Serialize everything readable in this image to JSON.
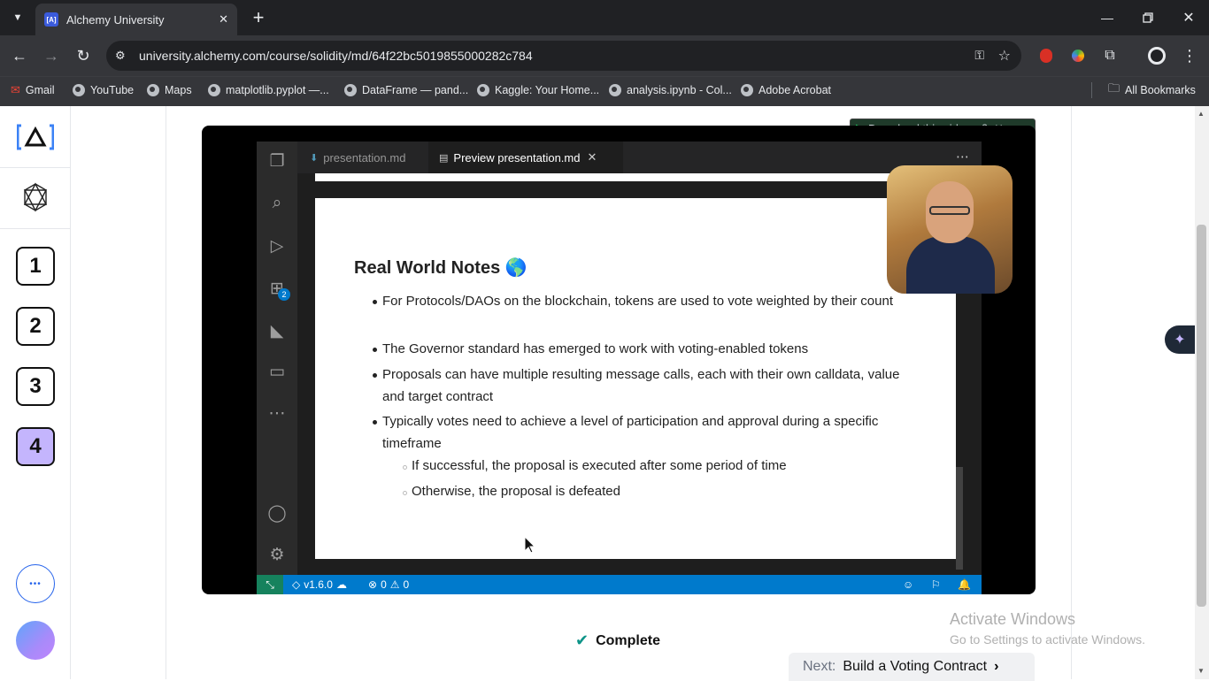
{
  "browser": {
    "tab_title": "Alchemy University",
    "favicon_text": "[A]",
    "url": "university.alchemy.com/course/solidity/md/64f22bc5019855000282c784",
    "new_tab": "+",
    "bookmarks": [
      {
        "label": "Gmail"
      },
      {
        "label": "YouTube"
      },
      {
        "label": "Maps"
      },
      {
        "label": "matplotlib.pyplot —..."
      },
      {
        "label": "DataFrame — pand..."
      },
      {
        "label": "Kaggle: Your Home..."
      },
      {
        "label": "analysis.ipynb - Col..."
      },
      {
        "label": "Adobe Acrobat"
      }
    ],
    "all_bookmarks": "All Bookmarks"
  },
  "sidebar": {
    "steps": [
      "1",
      "2",
      "3",
      "4"
    ],
    "active_step": "4",
    "more": "•••"
  },
  "video": {
    "download_label": "Download this video",
    "tabs": [
      {
        "label": "presentation.md"
      },
      {
        "label": "Preview presentation.md"
      }
    ],
    "extensions_badge": "2",
    "slide": {
      "title": "Real World Notes 🌎",
      "bullets": [
        "For Protocols/DAOs on the blockchain, tokens are used to vote weighted by their count",
        "The Governor standard has emerged to work with voting-enabled tokens",
        "Proposals can have multiple resulting message calls, each with their own calldata, value and target contract",
        "Typically votes need to achieve a level of participation and approval during a specific timeframe"
      ],
      "sub_bullets": [
        "If successful, the proposal is executed after some period of time",
        "Otherwise, the proposal is defeated"
      ]
    },
    "status": {
      "version": "v1.6.0",
      "errors": "0",
      "warnings": "0"
    }
  },
  "footer": {
    "complete_label": "Complete",
    "next_prefix": "Next:",
    "next_title": "Build a Voting Contract"
  },
  "watermark": {
    "title": "Activate Windows",
    "subtitle": "Go to Settings to activate Windows."
  }
}
